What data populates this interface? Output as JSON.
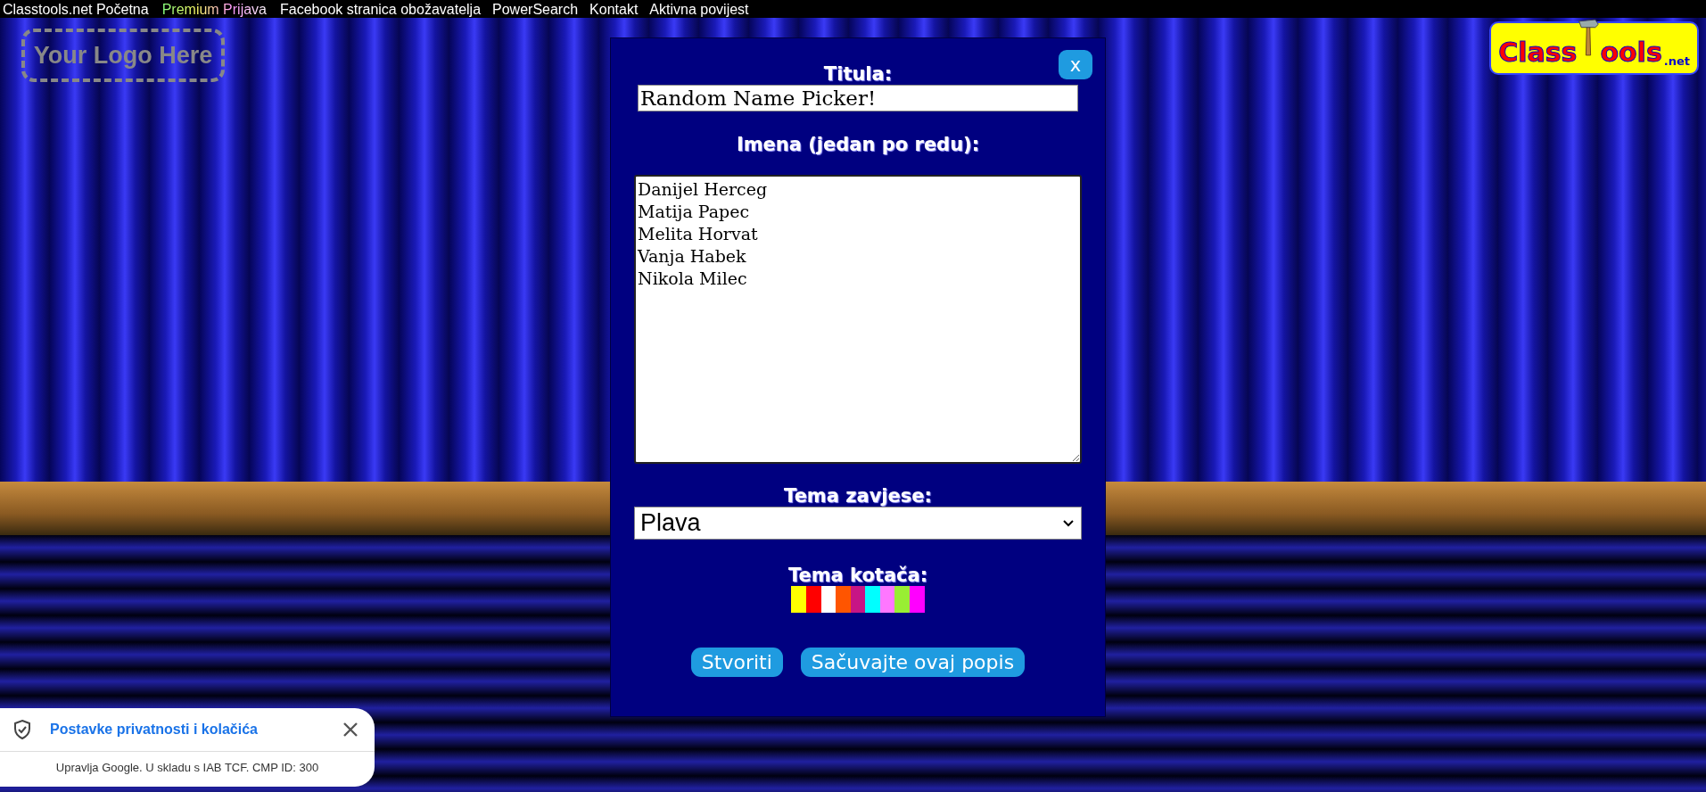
{
  "nav": [
    {
      "label": "Classtools.net Početna",
      "kind": "plain"
    },
    {
      "label": "Premium Prijava",
      "kind": "premium"
    },
    {
      "label": "Facebook stranica obožavatelja",
      "kind": "plain"
    },
    {
      "label": "PowerSearch",
      "kind": "plain"
    },
    {
      "label": "Kontakt",
      "kind": "plain"
    },
    {
      "label": "Aktivna povijest",
      "kind": "plain"
    }
  ],
  "logo_placeholder": "Your Logo Here",
  "brand": {
    "left": "Class",
    "right": "ools",
    "suffix": ".net"
  },
  "dialog": {
    "close": "x",
    "title_label": "Titula:",
    "title_value": "Random Name Picker!",
    "names_label": "Imena (jedan po redu):",
    "names": [
      "Danijel Herceg",
      "Matija Papec",
      "Melita Horvat",
      "Vanja Habek",
      "Nikola Milec"
    ],
    "curtain_label": "Tema zavjese:",
    "curtain_value": "Plava",
    "wheel_label": "Tema kotača:",
    "wheel_colors": [
      {
        "color": "#ffff00"
      },
      {
        "color": "#ff0000"
      },
      {
        "color": "#ffffff"
      },
      {
        "color": "#ff5500"
      },
      {
        "color": "#c71585"
      },
      {
        "color": "#00ffff"
      },
      {
        "color": "#ff77ff"
      },
      {
        "color": "#99ee33"
      },
      {
        "color": "#ff00ff"
      }
    ],
    "buttons": [
      "Stvoriti",
      "Sačuvajte ovaj popis"
    ]
  },
  "cookie": {
    "title": "Postavke privatnosti i kolačića",
    "note": "Upravlja Google. U skladu s IAB TCF. CMP ID: 300"
  }
}
